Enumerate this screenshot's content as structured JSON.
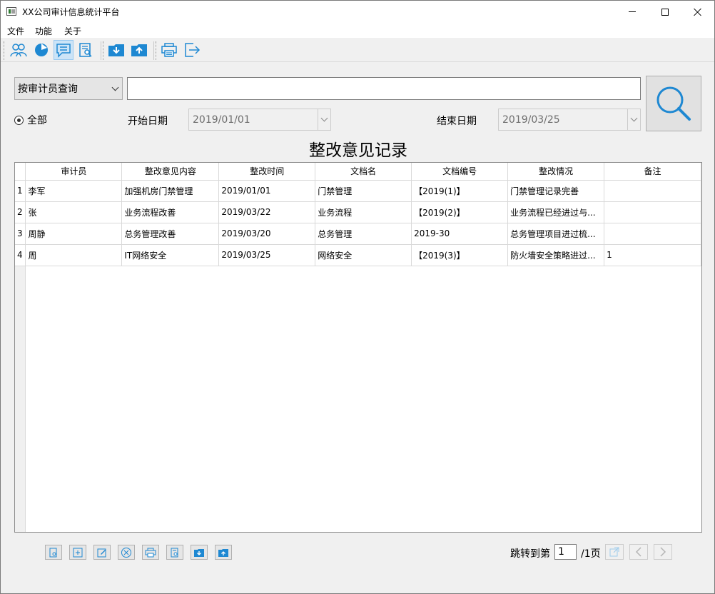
{
  "window": {
    "title": "XX公司审计信息统计平台"
  },
  "menu": {
    "items": [
      "文件",
      "功能",
      "关于"
    ]
  },
  "toolbar": {
    "icons": [
      "auditors-icon",
      "statistics-pie-icon",
      "comments-icon",
      "document-search-icon",
      "import-icon",
      "export-icon",
      "print-icon",
      "exit-icon"
    ],
    "active_index": 2
  },
  "search": {
    "mode": "按审计员查询",
    "value": "",
    "placeholder": ""
  },
  "filter": {
    "all_label": "全部",
    "start_label": "开始日期",
    "start_date": "2019/01/01",
    "end_label": "结束日期",
    "end_date": "2019/03/25"
  },
  "page_title": "整改意见记录",
  "table": {
    "columns": [
      "审计员",
      "整改意见内容",
      "整改时间",
      "文档名",
      "文档编号",
      "整改情况",
      "备注"
    ],
    "rows": [
      {
        "num": "1",
        "cells": [
          "李军",
          "加强机房门禁管理",
          "2019/01/01",
          "门禁管理",
          "【2019(1)】",
          "门禁管理记录完善",
          ""
        ]
      },
      {
        "num": "2",
        "cells": [
          "张",
          "业务流程改善",
          "2019/03/22",
          "业务流程",
          "【2019(2)】",
          "业务流程已经进过与...",
          ""
        ]
      },
      {
        "num": "3",
        "cells": [
          "周静",
          "总务管理改善",
          "2019/03/20",
          "总务管理",
          "2019-30",
          "总务管理项目进过梳...",
          ""
        ]
      },
      {
        "num": "4",
        "cells": [
          "周",
          "IT网络安全",
          "2019/03/25",
          "网络安全",
          "【2019(3)】",
          "防火墙安全策略进过...",
          "1"
        ]
      }
    ]
  },
  "pagination": {
    "jump_label": "跳转到第",
    "current": "1",
    "total_label": "/1页"
  },
  "colors": {
    "accent": "#1e88d2",
    "active_bg": "#cce4f7"
  }
}
